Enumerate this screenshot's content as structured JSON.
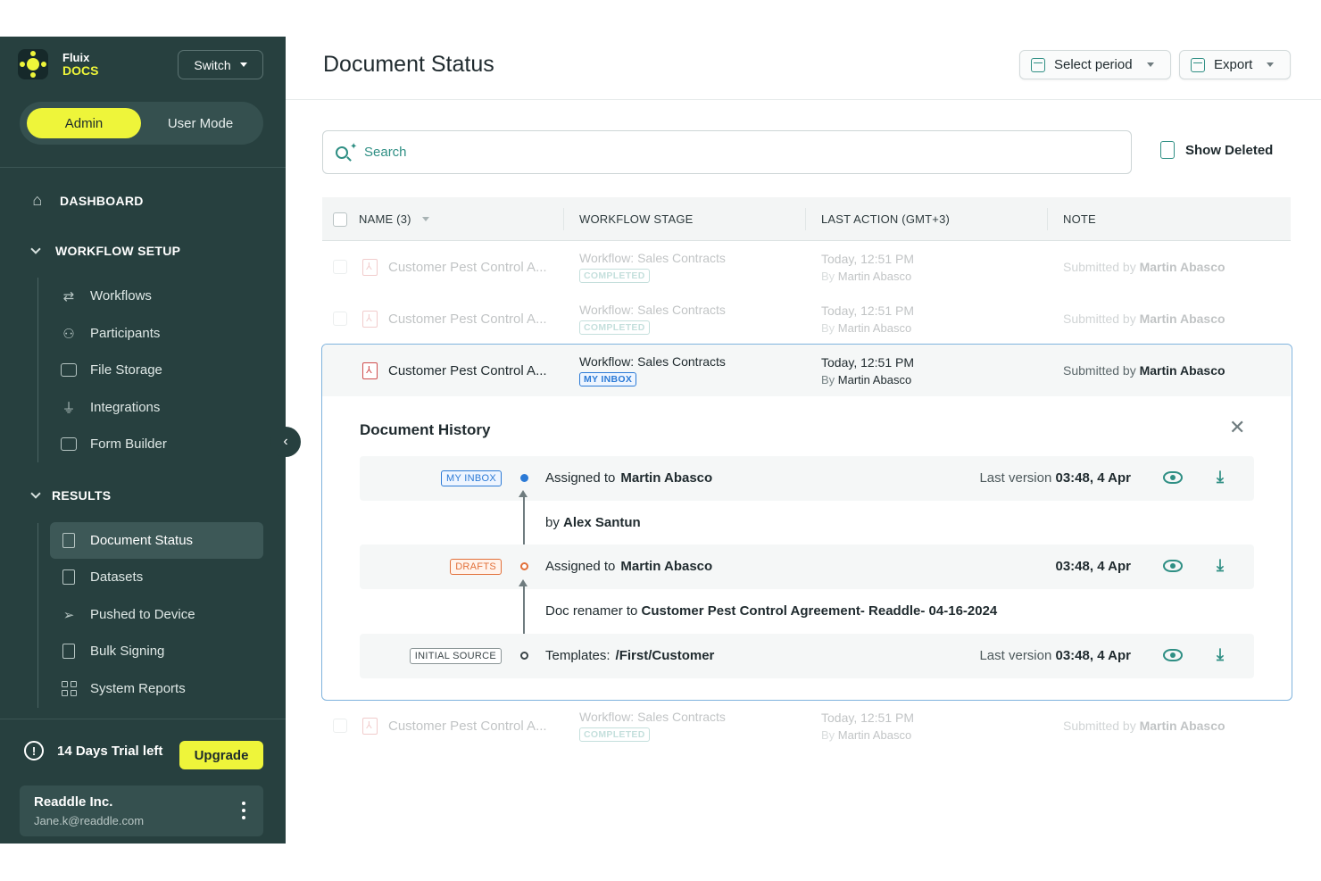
{
  "sidebar": {
    "brand": {
      "line1": "Fluix",
      "line2": "DOCS"
    },
    "switch_label": "Switch",
    "mode": {
      "admin": "Admin",
      "user": "User Mode"
    },
    "dashboard": "DASHBOARD",
    "workflow_setup": {
      "title": "WORKFLOW SETUP",
      "items": [
        "Workflows",
        "Participants",
        "File Storage",
        "Integrations",
        "Form Builder"
      ]
    },
    "results": {
      "title": "RESULTS",
      "items": [
        "Document Status",
        "Datasets",
        "Pushed to Device",
        "Bulk Signing",
        "System Reports"
      ]
    },
    "trial": "14 Days Trial left",
    "upgrade": "Upgrade",
    "account": {
      "name": "Readdle Inc.",
      "email": "Jane.k@readdle.com"
    }
  },
  "header": {
    "title": "Document Status",
    "select_period": "Select period",
    "export": "Export"
  },
  "search": {
    "placeholder": "Search"
  },
  "show_deleted": "Show Deleted",
  "table": {
    "columns": [
      "NAME (3)",
      "WORKFLOW STAGE",
      "LAST ACTION (GMT+3)",
      "NOTE"
    ],
    "rows": [
      {
        "name": "Customer Pest Control A...",
        "stage": "Workflow: Sales Contracts",
        "badge": "COMPLETED",
        "last_action": "Today, 12:51 PM",
        "by": "By",
        "actor": "Martin Abasco",
        "note_prefix": "Submitted by",
        "note_name": "Martin Abasco"
      },
      {
        "name": "Customer Pest Control A...",
        "stage": "Workflow: Sales Contracts",
        "badge": "COMPLETED",
        "last_action": "Today, 12:51 PM",
        "by": "By",
        "actor": "Martin Abasco",
        "note_prefix": "Submitted by",
        "note_name": "Martin Abasco"
      },
      {
        "name": "Customer Pest Control A...",
        "stage": "Workflow: Sales Contracts",
        "badge": "MY INBOX",
        "last_action": "Today, 12:51 PM",
        "by": "By",
        "actor": "Martin Abasco",
        "note_prefix": "Submitted by",
        "note_name": "Martin Abasco"
      },
      {
        "name": "Customer Pest Control A...",
        "stage": "Workflow: Sales Contracts",
        "badge": "COMPLETED",
        "last_action": "Today, 12:51 PM",
        "by": "By",
        "actor": "Martin Abasco",
        "note_prefix": "Submitted by",
        "note_name": "Martin Abasco"
      }
    ]
  },
  "history": {
    "title": "Document History",
    "entries": [
      {
        "badge": "MY INBOX",
        "label": "Assigned to",
        "value": "Martin Abasco",
        "version_prefix": "Last version",
        "version_time": "03:48, 4 Apr"
      },
      {
        "badge": "DRAFTS",
        "label": "Assigned to",
        "value": "Martin Abasco",
        "version_prefix": "",
        "version_time": "03:48, 4 Apr"
      },
      {
        "badge": "INITIAL SOURCE",
        "label": "Templates:",
        "value": "/First/Customer",
        "version_prefix": "Last version",
        "version_time": "03:48, 4 Apr"
      }
    ],
    "transitions": [
      {
        "prefix": "by",
        "value": "Alex Santun"
      },
      {
        "prefix": "Doc renamer to",
        "value": "Customer Pest Control Agreement- Readdle- 04-16-2024"
      }
    ]
  }
}
